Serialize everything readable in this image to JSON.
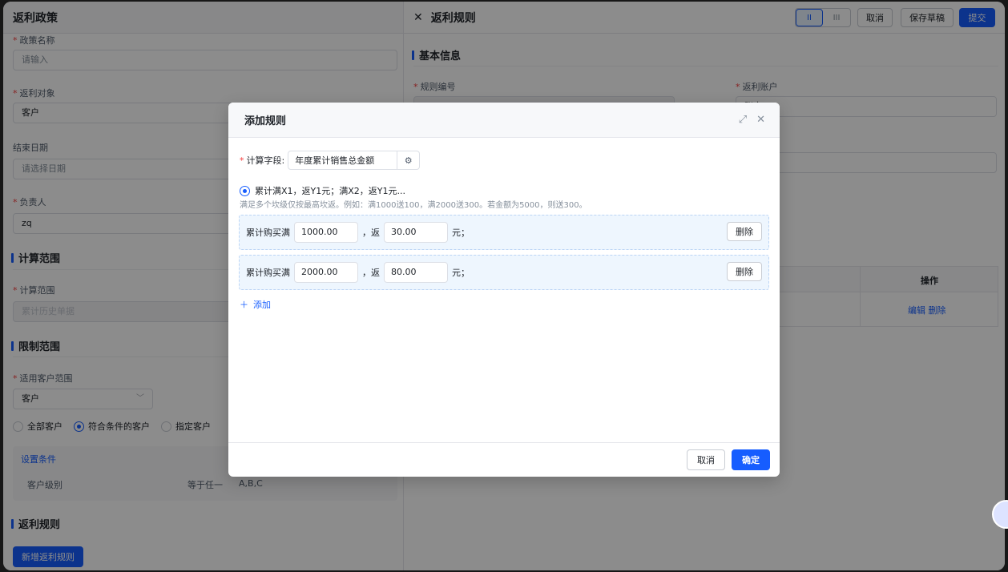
{
  "left": {
    "title": "返利政策",
    "policy_name_label": "政策名称",
    "policy_name_placeholder": "请输入",
    "target_label": "返利对象",
    "target_value": "客户",
    "end_date_label": "结束日期",
    "end_date_placeholder": "请选择日期",
    "owner_label": "负责人",
    "owner_value": "zq",
    "calc_section": "计算范围",
    "calc_label": "计算范围",
    "calc_value": "累计历史单据",
    "limit_section": "限制范围",
    "customer_scope_label": "适用客户范围",
    "customer_scope_value": "客户",
    "radio_all": "全部客户",
    "radio_match": "符合条件的客户",
    "radio_specified": "指定客户",
    "set_condition": "设置条件",
    "cond_field": "客户级别",
    "cond_op": "等于任一",
    "cond_value": "A,B,C",
    "rules_section": "返利规则",
    "add_rule_button": "新增返利规则"
  },
  "right": {
    "title": "返利规则",
    "toggle_1": "II",
    "toggle_2": "III",
    "cancel": "取消",
    "save_draft": "保存草稿",
    "submit": "提交",
    "basic_info": "基本信息",
    "rule_no_label": "规则编号",
    "account_label": "返利账户",
    "account_value": "账户",
    "table_op_header": "操作",
    "row_edit": "编辑",
    "row_delete": "删除"
  },
  "modal": {
    "title": "添加规则",
    "calc_field_label": "计算字段:",
    "calc_field_value": "年度累计销售总金额",
    "option_text": "累计满X1，返Y1元；满X2，返Y1元...",
    "hint": "满足多个坎级仅按最高坎返。例如：满1000送100，满2000送300。若金额为5000，则送300。",
    "tiers": [
      {
        "prefix": "累计购买满",
        "amount": "1000.00",
        "mid": "，返",
        "reward": "30.00",
        "suffix": "元；",
        "delete": "删除"
      },
      {
        "prefix": "累计购买满",
        "amount": "2000.00",
        "mid": "，返",
        "reward": "80.00",
        "suffix": "元；",
        "delete": "删除"
      }
    ],
    "add": "添加",
    "cancel": "取消",
    "confirm": "确定"
  },
  "colors": {
    "primary": "#165dff",
    "required": "#f53f3f"
  }
}
